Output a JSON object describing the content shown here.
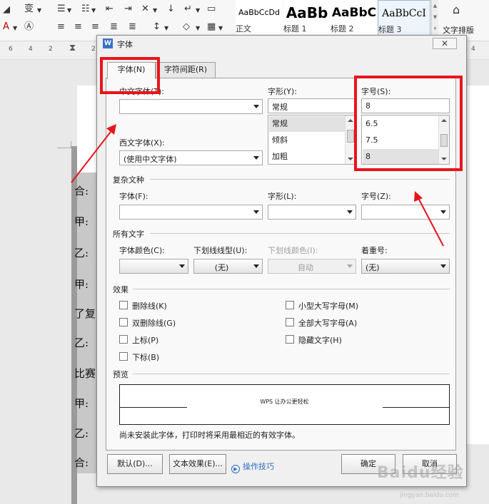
{
  "ribbon": {
    "style_gallery": [
      {
        "sample": "AaBbCcDd",
        "label": "正文"
      },
      {
        "sample": "AaBb",
        "label": "标题 1"
      },
      {
        "sample": "AaBbC",
        "label": "标题 2"
      },
      {
        "sample": "AaBbCcI",
        "label": "标题 3"
      }
    ],
    "text_layout_label": "文字排版",
    "ruler_marks": [
      "6",
      "4",
      "2",
      "2",
      "4"
    ]
  },
  "document": {
    "lines": [
      "合:",
      "甲:",
      "乙:",
      "甲:",
      "了复",
      "乙:",
      "比赛",
      "甲:",
      "乙:",
      "合:"
    ]
  },
  "dialog": {
    "title": "字体",
    "close_glyph": "✕",
    "tabs": [
      {
        "label": "字体(N)",
        "active": true
      },
      {
        "label": "字符间距(R)",
        "active": false
      }
    ],
    "font": {
      "chinese_font_label": "中文字体(T):",
      "chinese_font_value": "",
      "western_font_label": "西文字体(X):",
      "western_font_value": "(使用中文字体)",
      "style_label": "字形(Y):",
      "style_value": "常规",
      "style_options": [
        "常规",
        "倾斜",
        "加粗"
      ],
      "style_selected": "常规",
      "size_label": "字号(S):",
      "size_value": "8",
      "size_options": [
        "6.5",
        "7.5",
        "8"
      ],
      "size_selected": "8"
    },
    "complex": {
      "group_label": "复杂文种",
      "font_label": "字体(F):",
      "font_value": "",
      "style_label": "字形(L):",
      "style_value": "",
      "size_label": "字号(Z):",
      "size_value": ""
    },
    "all_text": {
      "group_label": "所有文字",
      "font_color_label": "字体颜色(C):",
      "font_color_value": "",
      "underline_style_label": "下划线线型(U):",
      "underline_style_value": "(无)",
      "underline_color_label": "下划线颜色(I):",
      "underline_color_value": "自动",
      "emphasis_label": "着重号:",
      "emphasis_value": "(无)"
    },
    "effects": {
      "group_label": "效果",
      "left": [
        {
          "label": "删除线(K)",
          "checked": false
        },
        {
          "label": "双删除线(G)",
          "checked": false
        },
        {
          "label": "上标(P)",
          "checked": false
        },
        {
          "label": "下标(B)",
          "checked": false
        }
      ],
      "right": [
        {
          "label": "小型大写字母(M)",
          "checked": false
        },
        {
          "label": "全部大写字母(A)",
          "checked": false
        },
        {
          "label": "隐藏文字(H)",
          "checked": false
        }
      ]
    },
    "preview": {
      "group_label": "预览",
      "sample_text": "WPS 让办公更轻松",
      "note": "尚未安装此字体，打印时将采用最相近的有效字体。"
    },
    "buttons": {
      "default": "默认(D)...",
      "text_effects": "文本效果(E)...",
      "tips_link": "操作技巧",
      "ok": "确定",
      "cancel": "取消"
    }
  },
  "watermark": {
    "text": "Baidu经验",
    "sub": "jingyan.baidu.com"
  },
  "annotation_color": "#e8141c"
}
